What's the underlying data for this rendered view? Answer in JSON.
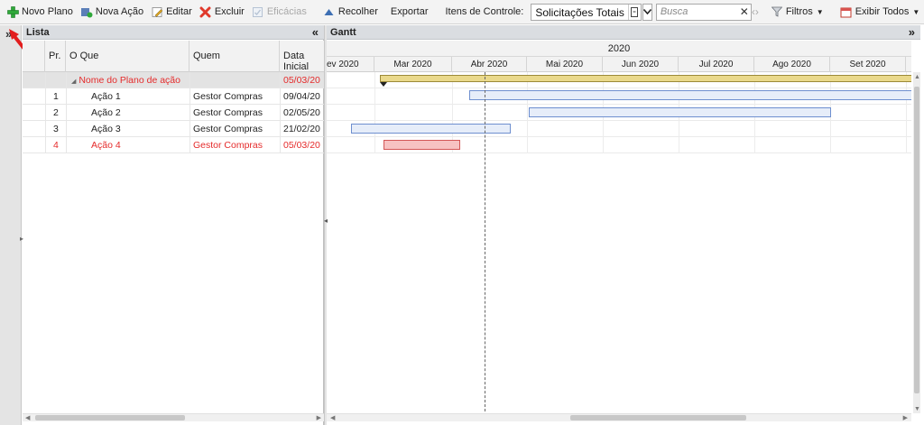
{
  "toolbar": {
    "new_plan": "Novo Plano",
    "new_action": "Nova Ação",
    "edit": "Editar",
    "delete": "Excluir",
    "efficacies": "Eficácias",
    "collapse": "Recolher",
    "export": "Exportar",
    "control_items_label": "Itens de Controle:",
    "control_items_value": "Solicitações Totais",
    "search_placeholder": "Busca",
    "filters": "Filtros",
    "show_all": "Exibir Todos"
  },
  "list": {
    "title": "Lista",
    "columns": [
      "Pr.",
      "O Que",
      "Quem",
      "Data Inicial"
    ],
    "group": {
      "name": "Nome do Plano de ação",
      "date": "05/03/20"
    },
    "rows": [
      {
        "pr": "1",
        "what": "Ação 1",
        "who": "Gestor Compras",
        "date": "09/04/20"
      },
      {
        "pr": "2",
        "what": "Ação 2",
        "who": "Gestor Compras",
        "date": "02/05/20"
      },
      {
        "pr": "3",
        "what": "Ação 3",
        "who": "Gestor Compras",
        "date": "21/02/20"
      },
      {
        "pr": "4",
        "what": "Ação 4",
        "who": "Gestor Compras",
        "date": "05/03/20"
      }
    ]
  },
  "gantt": {
    "title": "Gantt",
    "year": "2020",
    "months": [
      "ev 2020",
      "Mar 2020",
      "Abr 2020",
      "Mai 2020",
      "Jun 2020",
      "Jul 2020",
      "Ago 2020",
      "Set 2020"
    ]
  },
  "colors": {
    "summary_bar": "#ead98b",
    "task_bar": "#e6edf9",
    "late_bar": "#f7c2c2",
    "late_text": "#e52b2b"
  }
}
